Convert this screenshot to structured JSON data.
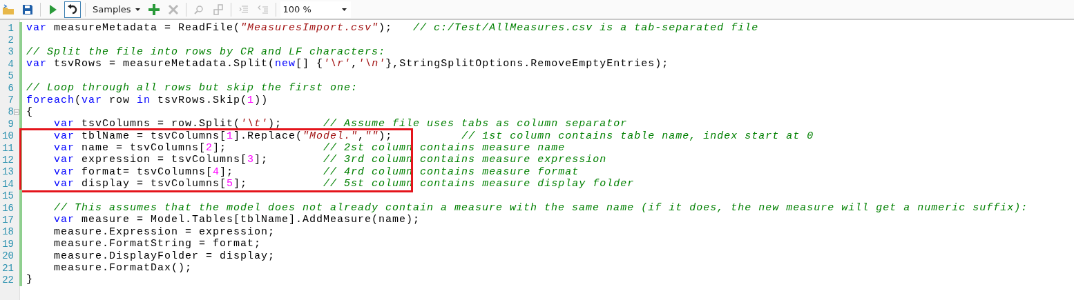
{
  "toolbar": {
    "buttons": [
      {
        "disabled": false,
        "pressed": false
      },
      {
        "disabled": false,
        "pressed": false
      },
      {
        "disabled": false,
        "pressed": false
      },
      {
        "disabled": false,
        "pressed": true
      },
      {
        "disabled": false,
        "pressed": false
      },
      {
        "disabled": true,
        "pressed": false
      },
      {
        "disabled": true,
        "pressed": false
      },
      {
        "disabled": true,
        "pressed": false
      },
      {
        "disabled": true,
        "pressed": false
      },
      {
        "disabled": true,
        "pressed": false
      }
    ],
    "samples_menu": {
      "label": "Samples"
    },
    "zoom": {
      "value": "100 %"
    }
  },
  "editor": {
    "lines": [
      {
        "number": "1",
        "boxed": false,
        "tokens": [
          {
            "kind": "keyword",
            "text": "var"
          },
          {
            "kind": "plain",
            "text": " measureMetadata = ReadFile("
          },
          {
            "kind": "string",
            "text": "\"MeasuresImport.csv\""
          },
          {
            "kind": "plain",
            "text": ");   "
          },
          {
            "kind": "comment",
            "text": "// c:/Test/AllMeasures.csv is a tab-separated file"
          }
        ]
      },
      {
        "number": "2",
        "boxed": false
      },
      {
        "number": "3",
        "boxed": false,
        "tokens": [
          {
            "kind": "comment",
            "text": "// Split the file into rows by CR and LF characters:"
          }
        ]
      },
      {
        "number": "4",
        "boxed": false,
        "tokens": [
          {
            "kind": "keyword",
            "text": "var"
          },
          {
            "kind": "plain",
            "text": " tsvRows = measureMetadata.Split("
          },
          {
            "kind": "keyword",
            "text": "new"
          },
          {
            "kind": "plain",
            "text": "[] {"
          },
          {
            "kind": "string",
            "text": "'\\r'"
          },
          {
            "kind": "plain",
            "text": ","
          },
          {
            "kind": "string",
            "text": "'\\n'"
          },
          {
            "kind": "plain",
            "text": "},StringSplitOptions.RemoveEmptyEntries);"
          }
        ]
      },
      {
        "number": "5",
        "boxed": false
      },
      {
        "number": "6",
        "boxed": false,
        "tokens": [
          {
            "kind": "comment",
            "text": "// Loop through all rows but skip the first one:"
          }
        ]
      },
      {
        "number": "7",
        "boxed": false,
        "tokens": [
          {
            "kind": "keyword",
            "text": "foreach"
          },
          {
            "kind": "plain",
            "text": "("
          },
          {
            "kind": "keyword",
            "text": "var"
          },
          {
            "kind": "plain",
            "text": " row "
          },
          {
            "kind": "keyword",
            "text": "in"
          },
          {
            "kind": "plain",
            "text": " tsvRows.Skip("
          },
          {
            "kind": "number",
            "text": "1"
          },
          {
            "kind": "plain",
            "text": "))"
          }
        ]
      },
      {
        "number": "8",
        "boxed": false,
        "fold_expanded": true,
        "tokens": [
          {
            "kind": "plain",
            "text": "{"
          }
        ]
      },
      {
        "number": "9",
        "boxed": false,
        "tokens": [
          {
            "kind": "keyword",
            "text": "    var"
          },
          {
            "kind": "plain",
            "text": " tsvColumns = row.Split("
          },
          {
            "kind": "string",
            "text": "'\\t'"
          },
          {
            "kind": "plain",
            "text": ");      "
          },
          {
            "kind": "comment",
            "text": "// Assume file uses tabs as column separator"
          }
        ]
      },
      {
        "number": "10",
        "boxed": true,
        "tokens": [
          {
            "kind": "keyword",
            "text": "    var"
          },
          {
            "kind": "plain",
            "text": " tblName = tsvColumns["
          },
          {
            "kind": "number",
            "text": "1"
          },
          {
            "kind": "plain",
            "text": "].Replace("
          },
          {
            "kind": "string",
            "text": "\"Model.\""
          },
          {
            "kind": "plain",
            "text": ","
          },
          {
            "kind": "string",
            "text": "\"\""
          },
          {
            "kind": "plain",
            "text": ");          "
          },
          {
            "kind": "comment",
            "text": "// 1st column contains table name, index start at 0"
          }
        ]
      },
      {
        "number": "11",
        "boxed": true,
        "tokens": [
          {
            "kind": "keyword",
            "text": "    var"
          },
          {
            "kind": "plain",
            "text": " name = tsvColumns["
          },
          {
            "kind": "number",
            "text": "2"
          },
          {
            "kind": "plain",
            "text": "];              "
          },
          {
            "kind": "comment",
            "text": "// 2st column contains measure name"
          }
        ]
      },
      {
        "number": "12",
        "boxed": true,
        "tokens": [
          {
            "kind": "keyword",
            "text": "    var"
          },
          {
            "kind": "plain",
            "text": " expression = tsvColumns["
          },
          {
            "kind": "number",
            "text": "3"
          },
          {
            "kind": "plain",
            "text": "];        "
          },
          {
            "kind": "comment",
            "text": "// 3rd column contains measure expression"
          }
        ]
      },
      {
        "number": "13",
        "boxed": true,
        "tokens": [
          {
            "kind": "keyword",
            "text": "    var"
          },
          {
            "kind": "plain",
            "text": " format= tsvColumns["
          },
          {
            "kind": "number",
            "text": "4"
          },
          {
            "kind": "plain",
            "text": "];             "
          },
          {
            "kind": "comment",
            "text": "// 4rd column contains measure format"
          }
        ]
      },
      {
        "number": "14",
        "boxed": true,
        "tokens": [
          {
            "kind": "keyword",
            "text": "    var"
          },
          {
            "kind": "plain",
            "text": " display = tsvColumns["
          },
          {
            "kind": "number",
            "text": "5"
          },
          {
            "kind": "plain",
            "text": "];           "
          },
          {
            "kind": "comment",
            "text": "// 5st column contains measure display folder"
          }
        ]
      },
      {
        "number": "15",
        "boxed": false
      },
      {
        "number": "16",
        "boxed": false,
        "tokens": [
          {
            "kind": "comment",
            "text": "    // This assumes that the model does not already contain a measure with the same name (if it does, the new measure will get a numeric suffix):"
          }
        ]
      },
      {
        "number": "17",
        "boxed": false,
        "tokens": [
          {
            "kind": "keyword",
            "text": "    var"
          },
          {
            "kind": "plain",
            "text": " measure = Model.Tables[tblName].AddMeasure(name);"
          }
        ]
      },
      {
        "number": "18",
        "boxed": false,
        "tokens": [
          {
            "kind": "plain",
            "text": "    measure.Expression = expression;"
          }
        ]
      },
      {
        "number": "19",
        "boxed": false,
        "tokens": [
          {
            "kind": "plain",
            "text": "    measure.FormatString = format;"
          }
        ]
      },
      {
        "number": "20",
        "boxed": false,
        "tokens": [
          {
            "kind": "plain",
            "text": "    measure.DisplayFolder = display;"
          }
        ]
      },
      {
        "number": "21",
        "boxed": false,
        "tokens": [
          {
            "kind": "plain",
            "text": "    measure.FormatDax();"
          }
        ]
      },
      {
        "number": "22",
        "boxed": false,
        "tokens": [
          {
            "kind": "plain",
            "text": "}"
          }
        ]
      }
    ]
  }
}
